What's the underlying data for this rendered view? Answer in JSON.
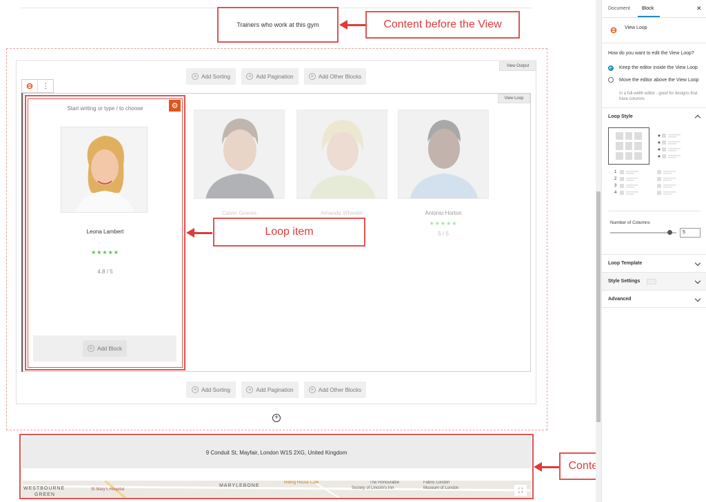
{
  "callouts": {
    "before_view": "Content before the View",
    "loop_item": "Loop item",
    "after_view": "Content after the View"
  },
  "content_before": "Trainers who work at this gym",
  "view_output_tag": "View Output",
  "view_loop_tag": "View Loop",
  "toolbar_top": {
    "sorting": "Add Sorting",
    "pagination": "Add Pagination",
    "other": "Add Other Blocks"
  },
  "toolbar_bottom": {
    "sorting": "Add Sorting",
    "pagination": "Add Pagination",
    "other": "Add Other Blocks"
  },
  "loop_item": {
    "placeholder": "Start writing or type / to choose",
    "name": "Leona Lambert",
    "stars": "★★★★★",
    "rating": "4.8 / 5",
    "add_block": "Add Block"
  },
  "trainers": [
    {
      "name": "Calvin Graves",
      "stars": "",
      "rating": ""
    },
    {
      "name": "Amanda Wheeler",
      "stars": "",
      "rating": ""
    },
    {
      "name": "Antonio Horton",
      "stars": "★★★★★",
      "rating": "5 / 5"
    }
  ],
  "content_after": {
    "address": "9 Conduit St, Mayfair, London W1S 2XG, United Kingdom",
    "map_labels": [
      "WESTBOURNE",
      "GREEN",
      "St Mary's Hospital",
      "MARYLEBONE",
      "Riding House Café",
      "The Honourable",
      "Society of Lincoln's Inn",
      "Fabric London",
      "Museum of London"
    ]
  },
  "sidebar": {
    "tabs": [
      "Document",
      "Block"
    ],
    "active_tab": "Block",
    "block_name": "View Loop",
    "question": "How do you want to edit the View Loop?",
    "options": [
      {
        "label": "Keep the editor inside the View Loop",
        "selected": true
      },
      {
        "label": "Move the editor above the View Loop",
        "selected": false,
        "hint": "In a full-width editor - good for designs that have columns"
      }
    ],
    "loop_style": "Loop Style",
    "list_numbers": [
      "1",
      "2",
      "3",
      "4"
    ],
    "columns_label": "Number of Columns",
    "columns_value": "5",
    "columns_fraction": 0.9,
    "sections": [
      "Loop Template",
      "Style Settings",
      "Advanced"
    ]
  },
  "colors": {
    "accent_red": "#e03a3a",
    "star_green": "#52c152",
    "wp_blue": "#1e8cbe",
    "gear_orange": "#e0561a"
  }
}
